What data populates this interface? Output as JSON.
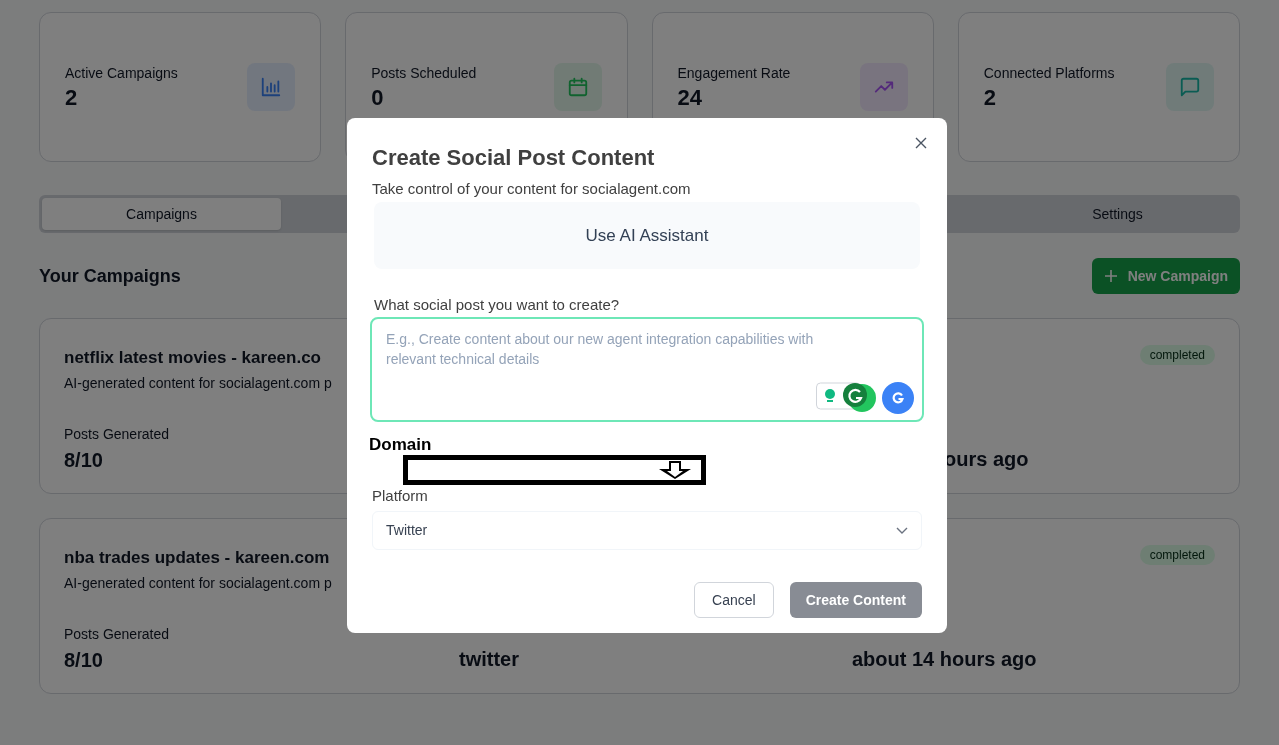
{
  "stats": [
    {
      "label": "Active Campaigns",
      "value": "2",
      "kind": "bars"
    },
    {
      "label": "Posts Scheduled",
      "value": "0",
      "kind": "calendar"
    },
    {
      "label": "Engagement Rate",
      "value": "24",
      "kind": "trend"
    },
    {
      "label": "Connected Platforms",
      "value": "2",
      "kind": "chat"
    }
  ],
  "tabs": [
    {
      "label": "Campaigns",
      "selected": true
    },
    {
      "label": "Settings",
      "selected": false
    }
  ],
  "section_title": "Your Campaigns",
  "new_campaign_button": "New Campaign",
  "campaigns": [
    {
      "title": "netflix latest movies - kareen.co",
      "description": "AI-generated content for socialagent.com p",
      "status": "completed",
      "posts_label": "Posts Generated",
      "posts_value": "8/10",
      "next_post_value": "ours ago"
    },
    {
      "title": "nba trades updates - kareen.com",
      "description": "AI-generated content for socialagent.com p",
      "status": "completed",
      "posts_label": "Posts Generated",
      "posts_value": "8/10",
      "platforms_value": "twitter",
      "next_post_value": "about 14 hours ago"
    }
  ],
  "dialog": {
    "title": "Create Social Post Content",
    "subtitle": "Take control of your content for socialagent.com",
    "ai_button": "Use AI Assistant",
    "prompt_label": "What social post you want to create?",
    "prompt_placeholder": "E.g., Create content about our new agent integration capabilities with relevant technical details",
    "domain_label": "Domain",
    "platform_label": "Platform",
    "platform_value": "Twitter",
    "cancel": "Cancel",
    "submit": "Create Content"
  }
}
